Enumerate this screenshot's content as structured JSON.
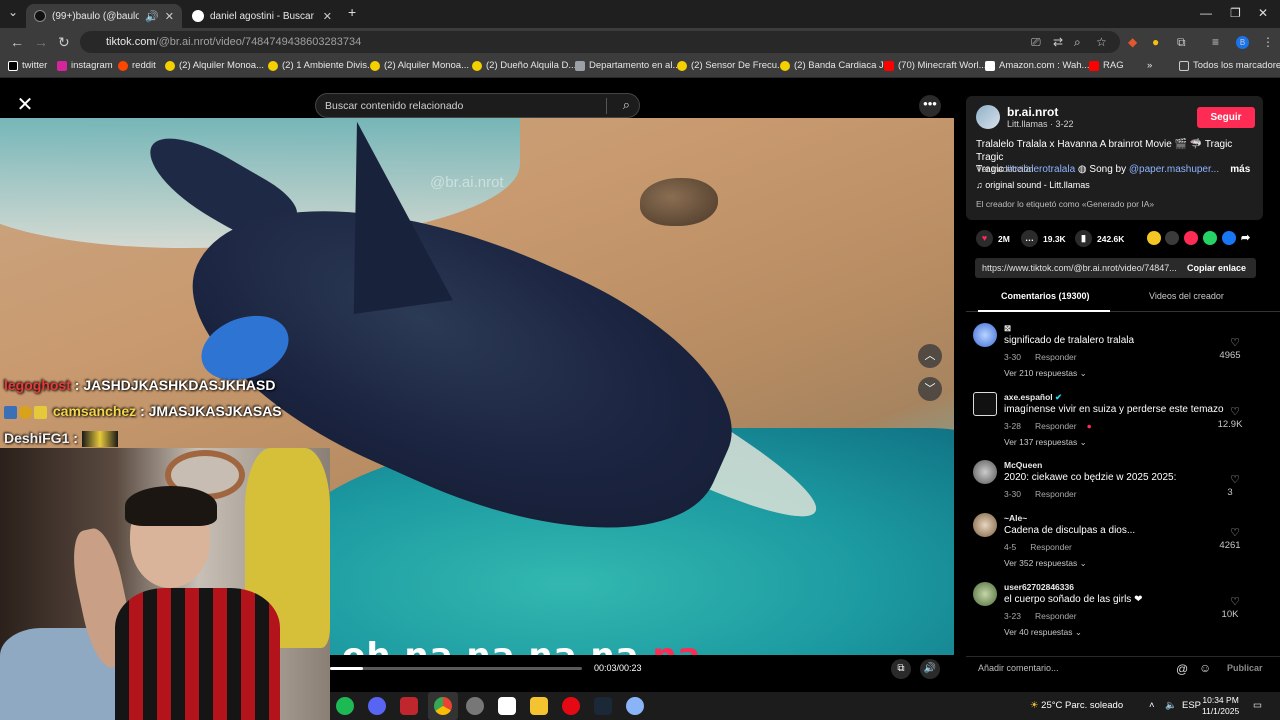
{
  "browser": {
    "tabs": [
      {
        "title": "(99+)baulo (@baulol) | TikT",
        "active": true
      },
      {
        "title": "daniel agostini - Buscar con Go",
        "active": false
      }
    ],
    "new_tab": "+",
    "url_host": "tiktok.com",
    "url_path": "/@br.ai.nrot/video/7484749438603283734",
    "bookmarks": [
      "twitter",
      "instagram",
      "reddit",
      "(2) Alquiler Monoa...",
      "(2) 1 Ambiente Divis...",
      "(2) Alquiler Monoa...",
      "(2) Dueño Alquila D...",
      "Departamento en al...",
      "(2) Sensor De Frecu...",
      "(2) Banda Cardiaca J...",
      "(70) Minecraft Worl...",
      "Amazon.com : Wah...",
      "RAG"
    ],
    "bookmarks_more": "»",
    "all_bookmarks": "Todos los marcadores"
  },
  "video": {
    "search_placeholder": "Buscar contenido relacionado",
    "watermark": "@br.ai.nrot",
    "lyric_white": "oh na na na na ",
    "lyric_red": "na",
    "time": "00:03/00:23",
    "progress": 0.13
  },
  "chat": [
    {
      "user": "legoghost",
      "msg": ": JASHDJKASHKDASJKHASD"
    },
    {
      "user": "camsanchez",
      "msg": ": JMASJKASJKASAS"
    },
    {
      "user": "DeshiFG1",
      "msg": ":"
    }
  ],
  "post": {
    "author": "br.ai.nrot",
    "subtitle": "Litt.llamas · 3-22",
    "follow": "Seguir",
    "desc_1": "Tralalelo Tralala x Havanna A brainrot Movie 🎬 🦈 Tragic Tragic",
    "desc_2a": "Tragic ",
    "desc_tag": "#tralalerotralala",
    "desc_2b": " ◍ Song by ",
    "desc_mention": "@paper.mashuper...",
    "desc_more": "más",
    "translate": "Ver traducción",
    "sound": "♫  original sound - Litt.llamas",
    "ai_label": "El creador lo etiquetó como «Generado por IA»",
    "likes": "2M",
    "comments_count": "19.3K",
    "saves": "242.6K",
    "link": "https://www.tiktok.com/@br.ai.nrot/video/74847...",
    "copy": "Copiar enlace",
    "tab_comments": "Comentarios (19300)",
    "tab_videos": "Videos del creador"
  },
  "comments": [
    {
      "name": "⊠",
      "text": "significado de tralalero tralala",
      "date": "3-30",
      "reply": "Responder",
      "replies": "Ver 210 respuestas ⌄",
      "likes": "4965"
    },
    {
      "name": "axe.español",
      "text": "imagínense vivir en suiza y perderse este temazo",
      "date": "3-28",
      "reply": "Responder",
      "replies": "Ver 137 respuestas ⌄",
      "likes": "12.9K"
    },
    {
      "name": "McQueen",
      "text": "2020: ciekawe co będzie w 2025 2025:",
      "date": "3-30",
      "reply": "Responder",
      "replies": "",
      "likes": "3"
    },
    {
      "name": "~Ale~",
      "text": "Cadena de disculpas a dios...",
      "date": "4-5",
      "reply": "Responder",
      "replies": "Ver 352 respuestas ⌄",
      "likes": "4261"
    },
    {
      "name": "user62702846336",
      "text": "el cuerpo soñado de las girls ❤",
      "date": "3-23",
      "reply": "Responder",
      "replies": "Ver 40 respuestas ⌄",
      "likes": "10K"
    }
  ],
  "add_comment": {
    "placeholder": "Añadir comentario...",
    "publish": "Publicar"
  },
  "taskbar": {
    "weather": "25°C  Parc. soleado",
    "lang": "ESP",
    "time": "10:34 PM",
    "date": "11/1/2025"
  },
  "colors": {
    "accent": "#fe2c55",
    "tag": "#8fb4ff",
    "panel": "#1e1e1e"
  }
}
